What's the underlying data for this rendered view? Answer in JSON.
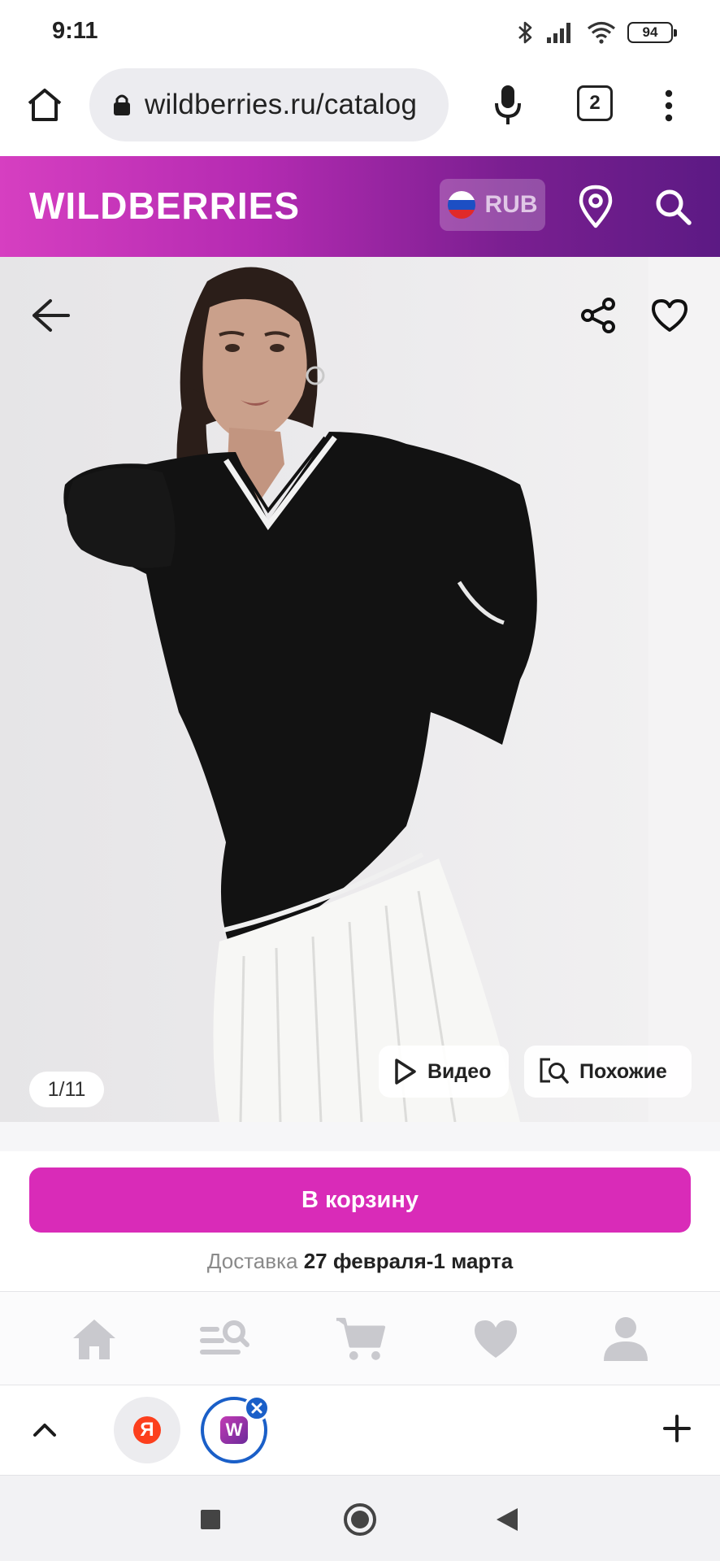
{
  "status_bar": {
    "time": "9:11",
    "battery": "94",
    "icons": [
      "bluetooth-icon",
      "signal-icon",
      "wifi-icon",
      "battery-icon"
    ]
  },
  "browser": {
    "url": "wildberries.ru/catalog",
    "tab_count": "2"
  },
  "header": {
    "logo": "WILDBERRIES",
    "currency": "RUB",
    "brand_gradient": [
      "#d63fc1",
      "#5c1a84"
    ]
  },
  "product": {
    "image_counter": "1/11",
    "video_label": "Видео",
    "similar_label": "Похожие"
  },
  "actions": {
    "cart_label": "В корзину",
    "delivery_label": "Доставка",
    "delivery_date": "27 февраля-1 марта",
    "accent_color": "#d92bb8"
  },
  "bottom_nav": {
    "items": [
      "home-icon",
      "catalog-search-icon",
      "cart-icon",
      "favorites-icon",
      "profile-icon"
    ]
  },
  "tab_strip": {
    "tabs": [
      {
        "name": "yandex",
        "glyph": "Я"
      },
      {
        "name": "wildberries",
        "glyph": "W",
        "active": true
      }
    ]
  }
}
